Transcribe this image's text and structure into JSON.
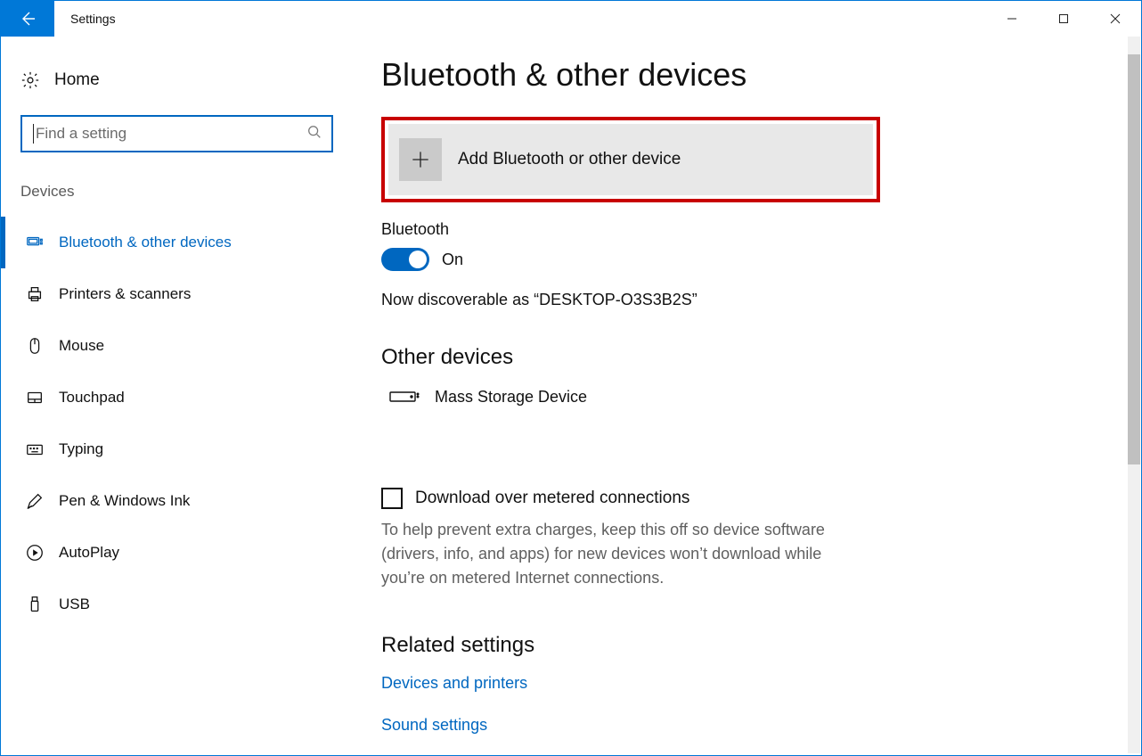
{
  "window": {
    "title": "Settings"
  },
  "sidebar": {
    "home_label": "Home",
    "search_placeholder": "Find a setting",
    "section_label": "Devices",
    "items": [
      {
        "label": "Bluetooth & other devices",
        "active": true
      },
      {
        "label": "Printers & scanners",
        "active": false
      },
      {
        "label": "Mouse",
        "active": false
      },
      {
        "label": "Touchpad",
        "active": false
      },
      {
        "label": "Typing",
        "active": false
      },
      {
        "label": "Pen & Windows Ink",
        "active": false
      },
      {
        "label": "AutoPlay",
        "active": false
      },
      {
        "label": "USB",
        "active": false
      }
    ]
  },
  "main": {
    "page_title": "Bluetooth & other devices",
    "add_device_label": "Add Bluetooth or other device",
    "bluetooth_label": "Bluetooth",
    "toggle_state": "On",
    "discoverable_text": "Now discoverable as “DESKTOP-O3S3B2S”",
    "other_devices_title": "Other devices",
    "other_devices": [
      {
        "name": "Mass Storage Device"
      }
    ],
    "metered_checkbox_label": "Download over metered connections",
    "metered_help": "To help prevent extra charges, keep this off so device software (drivers, info, and apps) for new devices won’t download while you’re on metered Internet connections.",
    "related_title": "Related settings",
    "related_links": [
      "Devices and printers",
      "Sound settings"
    ]
  }
}
